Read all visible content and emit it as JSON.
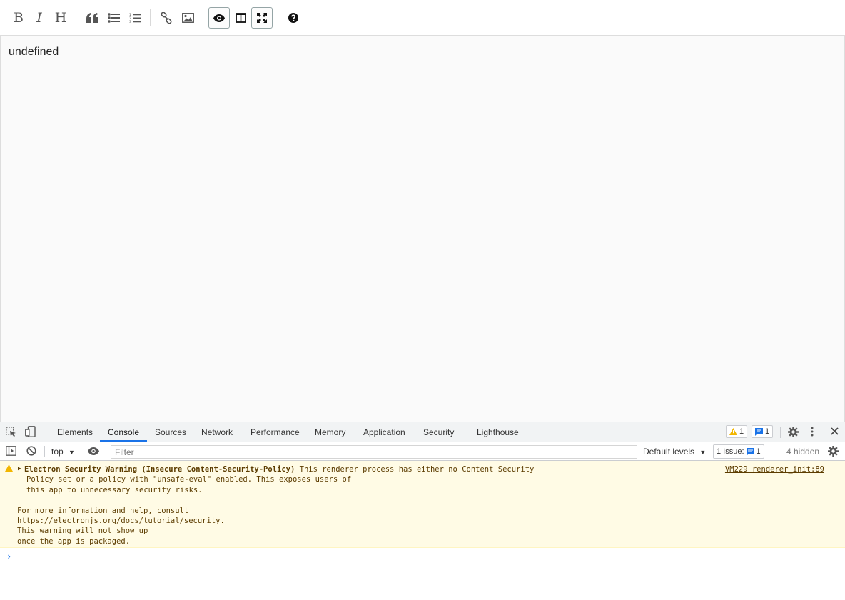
{
  "toolbar": {
    "bold": "B",
    "italic": "I",
    "heading": "H"
  },
  "preview": {
    "text": "undefined"
  },
  "devtools": {
    "tabs": [
      "Elements",
      "Console",
      "Sources",
      "Network",
      "Performance",
      "Memory",
      "Application",
      "Security",
      "Lighthouse"
    ],
    "active_tab": "Console",
    "warning_count": "1",
    "message_count": "1",
    "context": "top",
    "filter_placeholder": "Filter",
    "levels": "Default levels",
    "issues_label": "1 Issue:",
    "issues_count": "1",
    "hidden": "4 hidden",
    "console": {
      "warning_title": "Electron Security Warning (Insecure Content-Security-Policy)",
      "warning_line1_rest": " This renderer process has either no Content Security",
      "warning_line2": "Policy set or a policy with \"unsafe-eval\" enabled. This exposes users of",
      "warning_line3": "this app to unnecessary security risks.",
      "warning_line4": "For more information and help, consult",
      "warning_link": "https://electronjs.org/docs/tutorial/security",
      "warning_link_after": ".",
      "warning_line6": "This warning will not show up",
      "warning_line7": "once the app is packaged.",
      "source": "VM229 renderer_init:89",
      "prompt": "›"
    }
  },
  "colors": {
    "accent": "#1a73e8",
    "warning_bg": "#fffbe5",
    "warning_icon": "#f2b600"
  }
}
